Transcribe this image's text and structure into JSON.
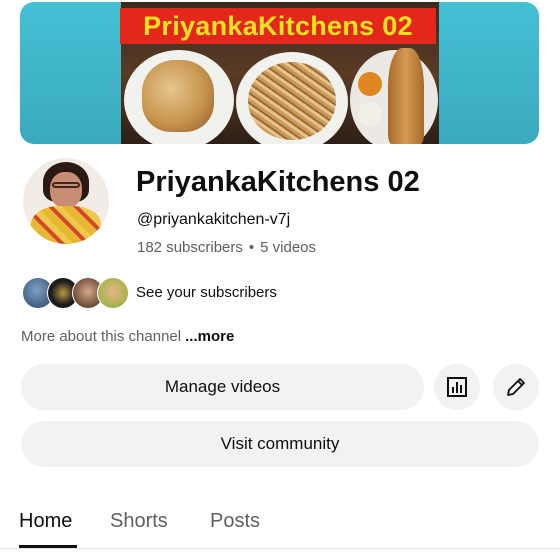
{
  "banner": {
    "title": "PriyankaKitchens 02"
  },
  "channel": {
    "name": "PriyankaKitchens 02",
    "handle": "@priyankakitchen-v7j",
    "subscribers": "182 subscribers",
    "separator": "•",
    "videos": "5 videos"
  },
  "subscribers_link": "See your subscribers",
  "about": {
    "text": "More about this channel",
    "more": "...more"
  },
  "buttons": {
    "manage": "Manage videos",
    "visit": "Visit community",
    "analytics_icon": "analytics-icon",
    "edit_icon": "pencil-icon"
  },
  "tabs": [
    {
      "label": "Home",
      "active": true
    },
    {
      "label": "Shorts",
      "active": false
    },
    {
      "label": "Posts",
      "active": false
    }
  ]
}
